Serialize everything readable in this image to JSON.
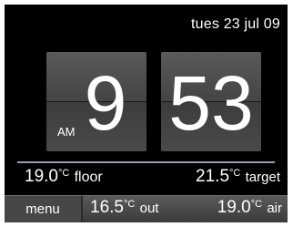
{
  "header": {
    "date": "tues 23 jul 09"
  },
  "clock": {
    "hours": "9",
    "minutes": "53",
    "meridiem": "AM"
  },
  "temperatures": {
    "floor": {
      "value": "19.0",
      "unit": "°C",
      "label": "floor"
    },
    "target": {
      "value": "21.5",
      "unit": "°C",
      "label": "target"
    }
  },
  "bottom_bar": {
    "menu_label": "menu",
    "out": {
      "value": "16.5",
      "unit": "°C",
      "label": "out"
    },
    "air": {
      "value": "19.0",
      "unit": "°C",
      "label": "air"
    }
  },
  "colors": {
    "background": "#000000",
    "tile": "#4a4a4a",
    "divider": "#8da0b8",
    "text": "#ffffff"
  }
}
